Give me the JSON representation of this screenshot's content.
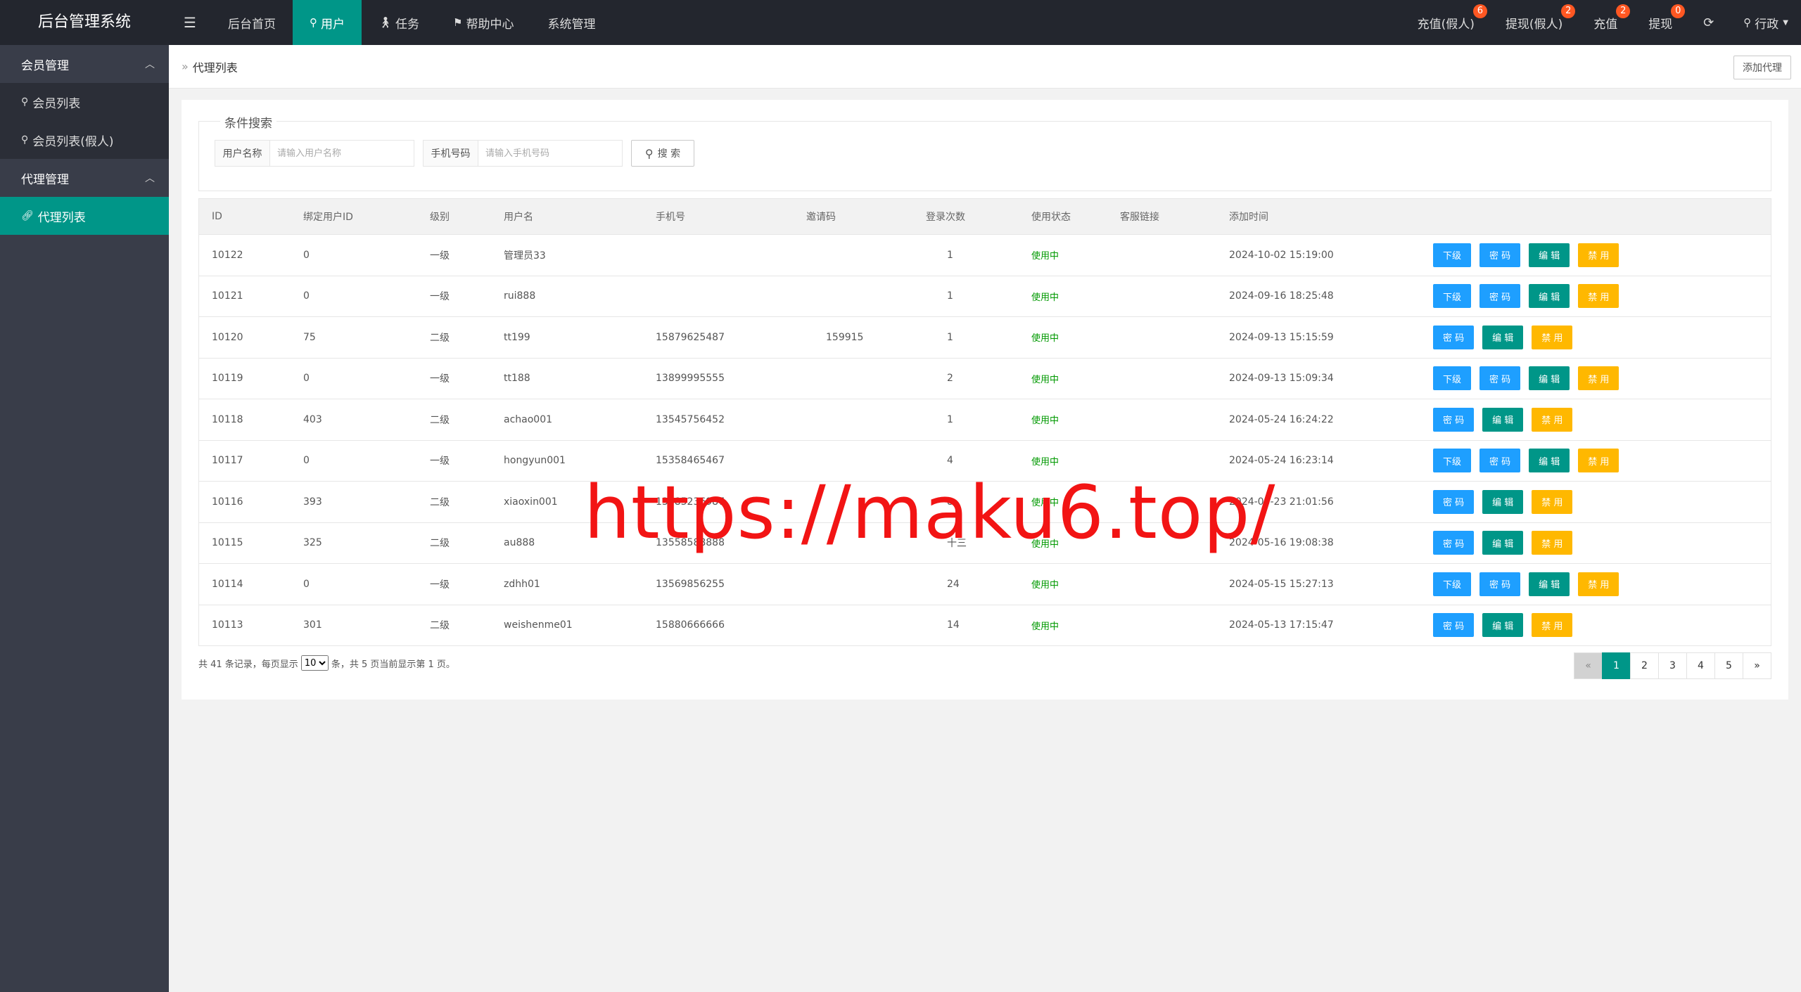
{
  "app": {
    "title": "后台管理系统"
  },
  "topnav": {
    "toggle": "☰",
    "items": [
      {
        "label": "后台首页",
        "icon": ""
      },
      {
        "label": "用户",
        "icon": "person-icon"
      },
      {
        "label": "任务",
        "icon": "walk-icon"
      },
      {
        "label": "帮助中心",
        "icon": "flag-icon"
      },
      {
        "label": "系统管理",
        "icon": ""
      }
    ]
  },
  "rightnav": {
    "items": [
      {
        "label": "充值(假人)",
        "badge": "6"
      },
      {
        "label": "提现(假人)",
        "badge": "2"
      },
      {
        "label": "充值",
        "badge": "2"
      },
      {
        "label": "提现",
        "badge": "0"
      }
    ],
    "user": "行政"
  },
  "sidebar": {
    "groups": [
      {
        "label": "会员管理",
        "items": [
          "会员列表",
          "会员列表(假人)"
        ]
      },
      {
        "label": "代理管理",
        "items": [
          "代理列表"
        ]
      }
    ]
  },
  "breadcrumb": {
    "current": "代理列表",
    "add_button": "添加代理"
  },
  "search": {
    "legend": "条件搜索",
    "username_label": "用户名称",
    "username_placeholder": "请输入用户名称",
    "phone_label": "手机号码",
    "phone_placeholder": "请输入手机号码",
    "button": "搜 索"
  },
  "table": {
    "headers": [
      "ID",
      "绑定用户ID",
      "级别",
      "用户名",
      "手机号",
      "邀请码",
      "登录次数",
      "使用状态",
      "客服链接",
      "添加时间"
    ],
    "buttons": {
      "sub": "下级",
      "pwd": "密 码",
      "edit": "编 辑",
      "disable": "禁 用"
    },
    "rows": [
      {
        "id": "10122",
        "bind": "0",
        "level": "一级",
        "user": "管理员33",
        "phone": "",
        "invite": "",
        "logins": "1",
        "status": "使用中",
        "link": "",
        "time": "2024-10-02 15:19:00"
      },
      {
        "id": "10121",
        "bind": "0",
        "level": "一级",
        "user": "rui888",
        "phone": "",
        "invite": "",
        "logins": "1",
        "status": "使用中",
        "link": "",
        "time": "2024-09-16 18:25:48"
      },
      {
        "id": "10120",
        "bind": "75",
        "level": "二级",
        "user": "tt199",
        "phone": "15879625487",
        "invite": "159915",
        "logins": "1",
        "status": "使用中",
        "link": "",
        "time": "2024-09-13 15:15:59"
      },
      {
        "id": "10119",
        "bind": "0",
        "level": "一级",
        "user": "tt188",
        "phone": "13899995555",
        "invite": "",
        "logins": "2",
        "status": "使用中",
        "link": "",
        "time": "2024-09-13 15:09:34"
      },
      {
        "id": "10118",
        "bind": "403",
        "level": "二级",
        "user": "achao001",
        "phone": "13545756452",
        "invite": "",
        "logins": "1",
        "status": "使用中",
        "link": "",
        "time": "2024-05-24 16:24:22"
      },
      {
        "id": "10117",
        "bind": "0",
        "level": "一级",
        "user": "hongyun001",
        "phone": "15358465467",
        "invite": "",
        "logins": "4",
        "status": "使用中",
        "link": "",
        "time": "2024-05-24 16:23:14"
      },
      {
        "id": "10116",
        "bind": "393",
        "level": "二级",
        "user": "xiaoxin001",
        "phone": "13785236987",
        "invite": "",
        "logins": "8",
        "status": "使用中",
        "link": "",
        "time": "2024-05-23 21:01:56"
      },
      {
        "id": "10115",
        "bind": "325",
        "level": "二级",
        "user": "au888",
        "phone": "13558588888",
        "invite": "",
        "logins": "十三",
        "status": "使用中",
        "link": "",
        "time": "2024-05-16 19:08:38"
      },
      {
        "id": "10114",
        "bind": "0",
        "level": "一级",
        "user": "zdhh01",
        "phone": "13569856255",
        "invite": "",
        "logins": "24",
        "status": "使用中",
        "link": "",
        "time": "2024-05-15 15:27:13"
      },
      {
        "id": "10113",
        "bind": "301",
        "level": "二级",
        "user": "weishenme01",
        "phone": "15880666666",
        "invite": "",
        "logins": "14",
        "status": "使用中",
        "link": "",
        "time": "2024-05-13 17:15:47"
      }
    ]
  },
  "footer": {
    "prefix": "共 41 条记录，每页显示",
    "page_size": "10",
    "suffix": "条，共 5 页当前显示第 1 页。"
  },
  "pager": {
    "prev": "«",
    "pages": [
      "1",
      "2",
      "3",
      "4",
      "5"
    ],
    "next": "»",
    "current": "1"
  },
  "watermark": "https://maku6.top/",
  "colors": {
    "header": "#23262e",
    "sidebar": "#393d49",
    "accent": "#009688",
    "blue": "#1e9fff",
    "yellow": "#ffb800",
    "badge": "#ff5722"
  }
}
